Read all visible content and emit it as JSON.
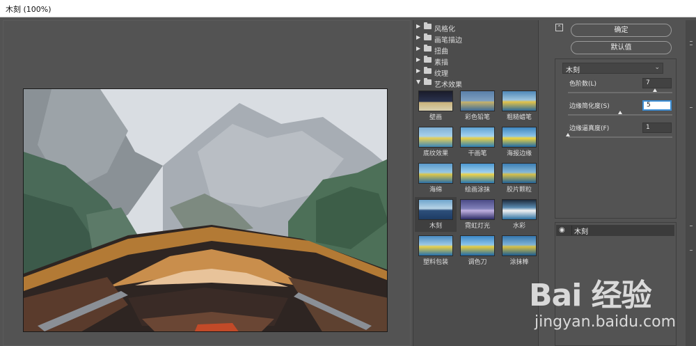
{
  "window": {
    "title": "木刻 (100%)"
  },
  "filter_gallery": {
    "categories": [
      {
        "label": "风格化",
        "expanded": false
      },
      {
        "label": "画笔描边",
        "expanded": false
      },
      {
        "label": "扭曲",
        "expanded": false
      },
      {
        "label": "素描",
        "expanded": false
      },
      {
        "label": "纹理",
        "expanded": false
      },
      {
        "label": "艺术效果",
        "expanded": true
      }
    ],
    "filters": [
      "壁画",
      "彩色铅笔",
      "粗糙蜡笔",
      "底纹效果",
      "干画笔",
      "海报边缘",
      "海绵",
      "绘画涂抹",
      "胶片颗粒",
      "木刻",
      "霓虹灯光",
      "水彩",
      "塑料包装",
      "调色刀",
      "涂抹棒"
    ],
    "selected_filter": "木刻"
  },
  "buttons": {
    "ok": "确定",
    "default": "默认值"
  },
  "settings": {
    "filter_select": "木刻",
    "params": [
      {
        "label": "色阶数(L)",
        "value": "7",
        "level": 0.83
      },
      {
        "label": "边缘简化度(S)",
        "value": "5",
        "level": 0.5
      },
      {
        "label": "边缘逼真度(F)",
        "value": "1",
        "level": 0.0
      }
    ]
  },
  "layers": {
    "items": [
      {
        "name": "木刻",
        "visible": true
      }
    ]
  },
  "icons": {
    "expanded_arrow": "triangle-down-icon",
    "collapsed_arrow": "triangle-right-icon",
    "folder": "folder-icon",
    "visibility": "eye-icon",
    "collapse": "collapse-icon"
  },
  "watermark": {
    "logo": "Bai 经验",
    "url": "jingyan.baidu.com"
  },
  "colors": {
    "ui_background": "#535353",
    "active_input_border": "#3d8fd6"
  }
}
